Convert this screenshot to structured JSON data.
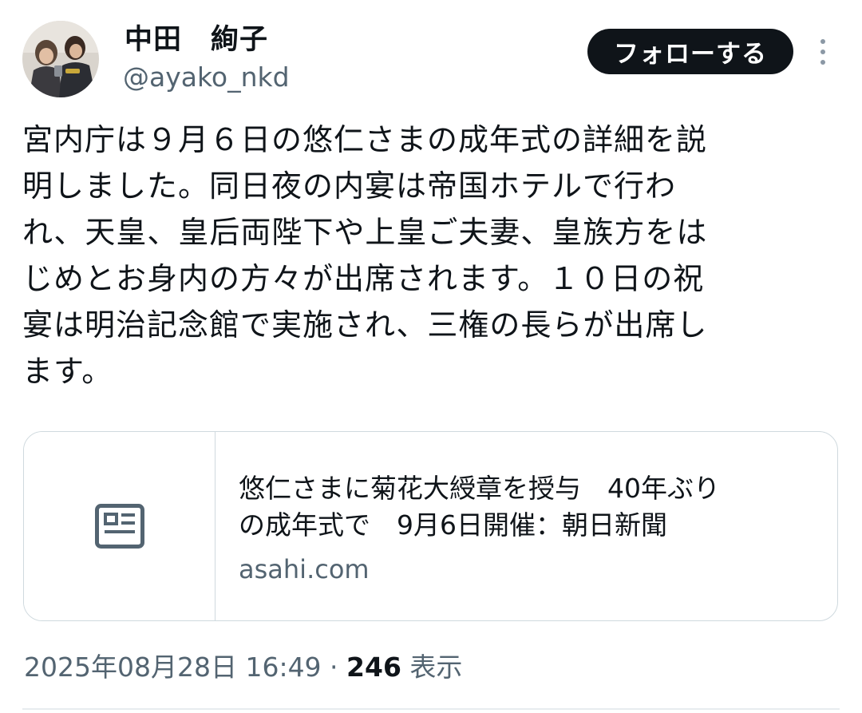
{
  "author": {
    "display_name": "中田　絢子",
    "handle": "@ayako_nkd"
  },
  "actions": {
    "follow_label": "フォローする",
    "more_icon": "more-vertical-icon"
  },
  "tweet": {
    "text": "宮内庁は９月６日の悠仁さまの成年式の詳細を説\n明しました。同日夜の内宴は帝国ホテルで行わ\nれ、天皇、皇后両陛下や上皇ご夫妻、皇族方をは\nじめとお身内の方々が出席されます。１０日の祝\n宴は明治記念館で実施され、三権の長らが出席し\nます。"
  },
  "link_card": {
    "thumbnail_icon": "newspaper-icon",
    "title": "悠仁さまに菊花大綬章を授与　40年ぶり\nの成年式で　9月6日開催：朝日新聞",
    "domain": "asahi.com"
  },
  "meta": {
    "timestamp": "2025年08月28日 16:49",
    "separator": " · ",
    "views_count": "246",
    "views_label": " 表示"
  },
  "colors": {
    "text_primary": "#0f1419",
    "text_secondary": "#536471",
    "border": "#cfd9de",
    "follow_bg": "#0f1419",
    "icon_gray": "#8b98a5"
  }
}
